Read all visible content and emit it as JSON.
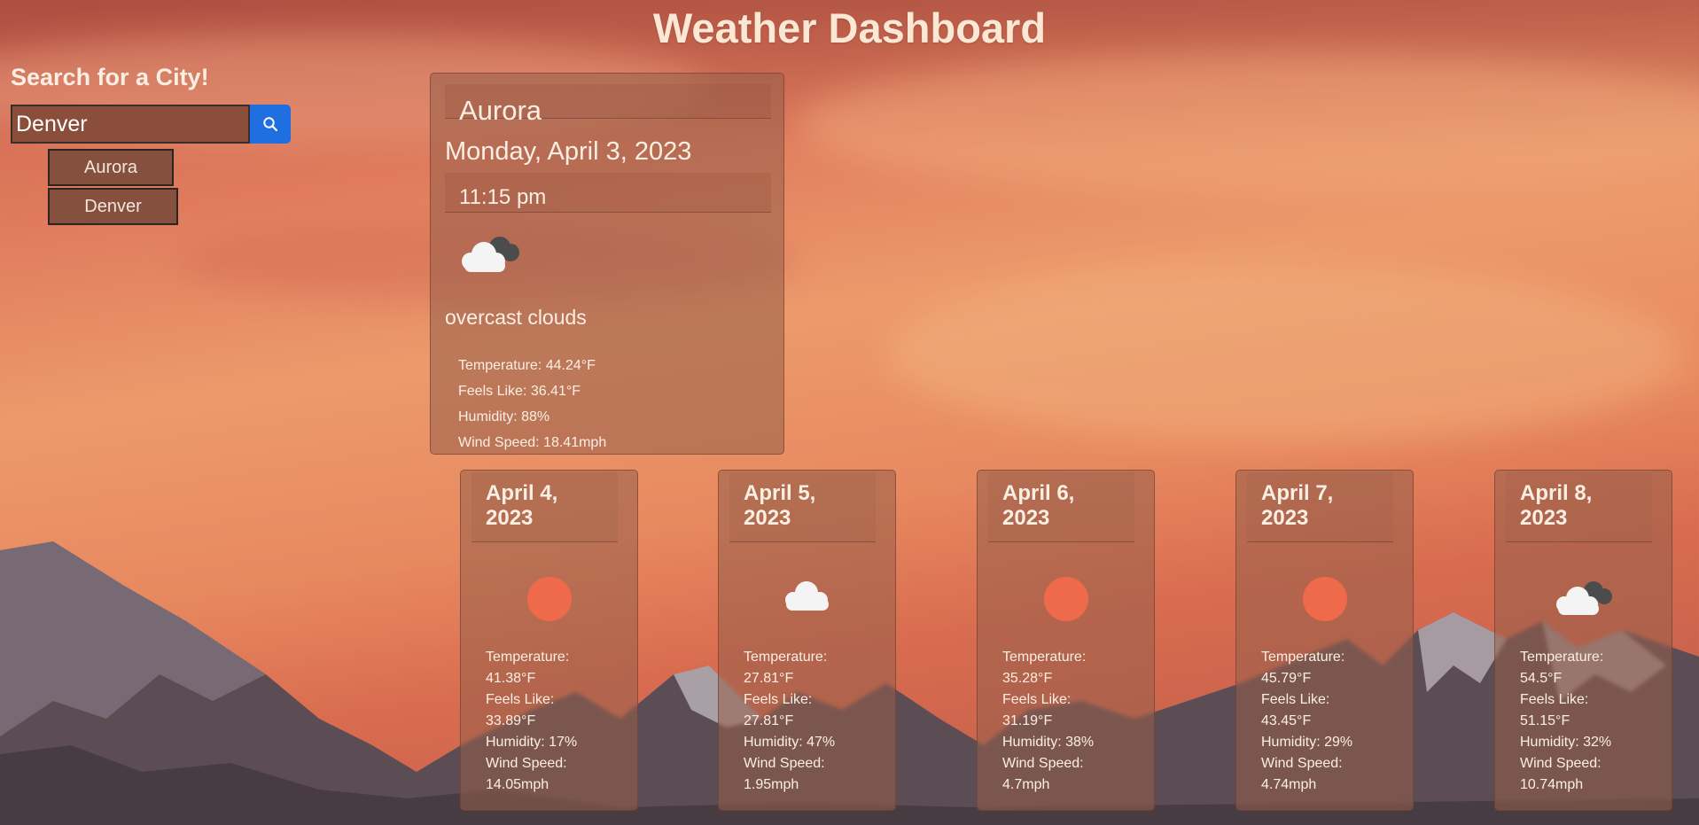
{
  "header": {
    "title": "Weather Dashboard"
  },
  "search": {
    "title": "Search for a City!",
    "input_value": "Denver",
    "button_icon": "search-icon",
    "history": [
      "Aurora",
      "Denver"
    ]
  },
  "current": {
    "city": "Aurora",
    "date": "Monday, April 3, 2023",
    "time": "11:15 pm",
    "icon": "overcast-clouds-icon",
    "description": "overcast clouds",
    "temperature": "Temperature: 44.24°F",
    "feels_like": "Feels Like: 36.41°F",
    "humidity": "Humidity: 88%",
    "wind": "Wind Speed: 18.41mph"
  },
  "forecast": [
    {
      "date_line1": "April 4,",
      "date_line2": "2023",
      "icon": "clear-sky-icon",
      "temp_label": "Temperature:",
      "temp": "41.38°F",
      "feels_label": "Feels Like:",
      "feels": "33.89°F",
      "humidity": "Humidity: 17%",
      "wind_label": "Wind Speed:",
      "wind": "14.05mph"
    },
    {
      "date_line1": "April 5,",
      "date_line2": "2023",
      "icon": "cloud-icon",
      "temp_label": "Temperature:",
      "temp": "27.81°F",
      "feels_label": "Feels Like:",
      "feels": "27.81°F",
      "humidity": "Humidity: 47%",
      "wind_label": "Wind Speed:",
      "wind": "1.95mph"
    },
    {
      "date_line1": "April 6,",
      "date_line2": "2023",
      "icon": "clear-sky-icon",
      "temp_label": "Temperature:",
      "temp": "35.28°F",
      "feels_label": "Feels Like:",
      "feels": "31.19°F",
      "humidity": "Humidity: 38%",
      "wind_label": "Wind Speed:",
      "wind": "4.7mph"
    },
    {
      "date_line1": "April 7,",
      "date_line2": "2023",
      "icon": "clear-sky-icon",
      "temp_label": "Temperature:",
      "temp": "45.79°F",
      "feels_label": "Feels Like:",
      "feels": "43.45°F",
      "humidity": "Humidity: 29%",
      "wind_label": "Wind Speed:",
      "wind": "4.74mph"
    },
    {
      "date_line1": "April 8,",
      "date_line2": "2023",
      "icon": "overcast-clouds-icon",
      "temp_label": "Temperature:",
      "temp": "54.5°F",
      "feels_label": "Feels Like:",
      "feels": "51.15°F",
      "humidity": "Humidity: 32%",
      "wind_label": "Wind Speed:",
      "wind": "10.74mph"
    }
  ],
  "colors": {
    "accent_button": "#1f6fe0",
    "sun": "#ef6a4b",
    "card": "#96604b"
  }
}
